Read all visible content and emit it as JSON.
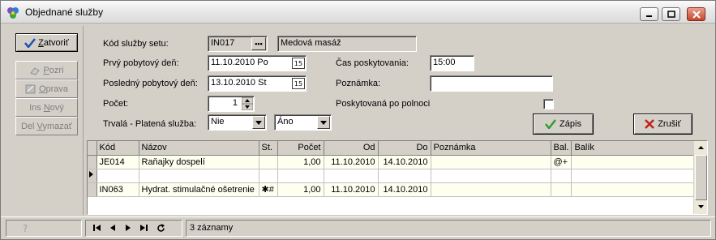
{
  "window": {
    "title": "Objednané služby"
  },
  "sidebar": {
    "close_label_pre": "",
    "close_label_u": "Z",
    "close_label_post": "atvoriť",
    "find_label_u": "P",
    "find_label_post": "ozri",
    "edit_label_u": "O",
    "edit_label_post": "prava",
    "ins_label_pre": "Ins ",
    "ins_label_u": "N",
    "ins_label_post": "ový",
    "del_label_pre": "Del ",
    "del_label_u": "V",
    "del_label_post": "ymazať"
  },
  "form": {
    "service_code_label": "Kód služby setu:",
    "service_code_value": "IN017",
    "service_code_button": "•••",
    "service_name_value": "Medová masáž",
    "first_day_label": "Prvý pobytový deň:",
    "first_day_value": "11.10.2010  Po",
    "last_day_label": "Posledný pobytový deň:",
    "last_day_value": "13.10.2010  St",
    "count_label": "Počet:",
    "count_value": "1",
    "paid_label": "Trvalá - Platená služba:",
    "permanent_value": "Nie",
    "paid_value": "Áno",
    "time_label": "Čas poskytovania:",
    "time_value": "15:00",
    "note_label": "Poznámka:",
    "note_value": "",
    "after_midnight_label": "Poskytovaná po polnoci",
    "calendar_glyph": "15",
    "save_label": "Zápis",
    "cancel_label": "Zrušiť"
  },
  "grid": {
    "columns": [
      "Kód",
      "Názov",
      "St.",
      "Počet",
      "Od",
      "Do",
      "Poznámka",
      "Bal.",
      "Balík"
    ],
    "rows": [
      {
        "code": "JE014",
        "name": "Raňajky dospelí",
        "st": "",
        "count": "1,00",
        "from": "11.10.2010",
        "to": "14.10.2010",
        "note": "",
        "bal": "@+",
        "package": ""
      },
      {
        "code": "",
        "name": "",
        "st": "",
        "count": "",
        "from": "",
        "to": "",
        "note": "",
        "bal": "",
        "package": ""
      },
      {
        "code": "IN063",
        "name": "Hydrat. stimulačné ošetrenie",
        "st": "✱#",
        "count": "1,00",
        "from": "11.10.2010",
        "to": "14.10.2010",
        "note": "",
        "bal": "",
        "package": ""
      }
    ]
  },
  "status": {
    "records": "3 záznamy"
  },
  "colors": {
    "accent_blue": "#1f4fb5",
    "save_green": "#2e9e2e",
    "cancel_red": "#c0201a"
  }
}
